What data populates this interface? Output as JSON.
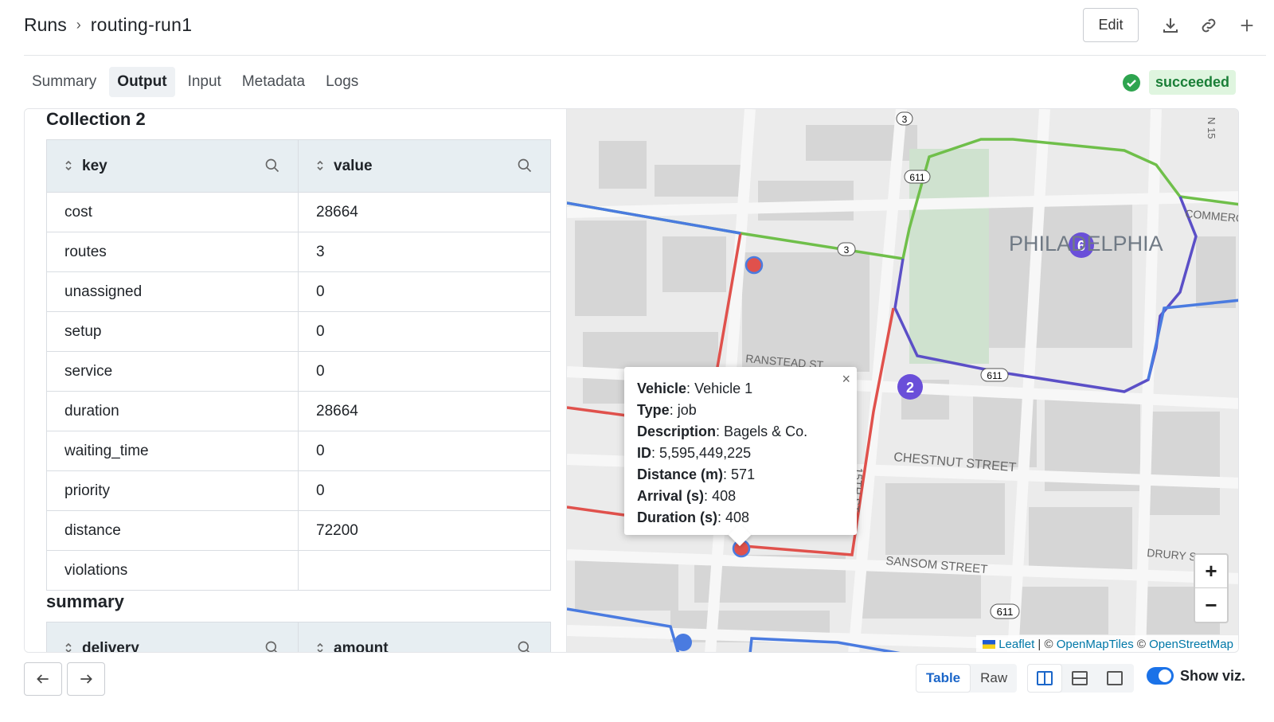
{
  "breadcrumb": {
    "root": "Runs",
    "separator": "›",
    "current": "routing-run1"
  },
  "toolbar": {
    "edit_label": "Edit"
  },
  "tabs": [
    {
      "label": "Summary",
      "active": false
    },
    {
      "label": "Output",
      "active": true
    },
    {
      "label": "Input",
      "active": false
    },
    {
      "label": "Metadata",
      "active": false
    },
    {
      "label": "Logs",
      "active": false
    }
  ],
  "status": {
    "label": "succeeded",
    "color": "#1a7f37"
  },
  "collection": {
    "title": "Collection 2",
    "columns": [
      "key",
      "value"
    ],
    "rows": [
      {
        "key": "cost",
        "value": "28664"
      },
      {
        "key": "routes",
        "value": "3"
      },
      {
        "key": "unassigned",
        "value": "0"
      },
      {
        "key": "setup",
        "value": "0"
      },
      {
        "key": "service",
        "value": "0"
      },
      {
        "key": "duration",
        "value": "28664"
      },
      {
        "key": "waiting_time",
        "value": "0"
      },
      {
        "key": "priority",
        "value": "0"
      },
      {
        "key": "distance",
        "value": "72200"
      },
      {
        "key": "violations",
        "value": ""
      }
    ]
  },
  "summary": {
    "title": "summary",
    "columns": [
      "delivery",
      "amount"
    ]
  },
  "map": {
    "labels": {
      "city": "PHILADELPHIA",
      "ranstead": "RANSTEAD ST",
      "chestnut": "CHESTNUT STREET",
      "sansom": "SANSOM STREET",
      "drury": "DRURY S",
      "commerce": "COMMERC",
      "n15": "N 15",
      "s15": "15TH ST",
      "shield_3": "3",
      "shield_611": "611"
    },
    "clusters": [
      {
        "count": "6"
      },
      {
        "count": "2"
      }
    ],
    "popup": {
      "close": "×",
      "rows": [
        {
          "label": "Vehicle",
          "value": "Vehicle 1"
        },
        {
          "label": "Type",
          "value": "job"
        },
        {
          "label": "Description",
          "value": "Bagels & Co."
        },
        {
          "label": "ID",
          "value": "5,595,449,225"
        },
        {
          "label": "Distance (m)",
          "value": "571"
        },
        {
          "label": "Arrival (s)",
          "value": "408"
        },
        {
          "label": "Duration (s)",
          "value": "408"
        }
      ]
    },
    "zoom_in": "+",
    "zoom_out": "−",
    "attribution": {
      "leaflet": "Leaflet",
      "sep": " | © ",
      "tiles": "OpenMapTiles",
      "sep2": " © ",
      "osm": "OpenStreetMap"
    },
    "route_colors": {
      "red": "#e0514c",
      "blue": "#4a7be0",
      "purple": "#5b4fc7",
      "green": "#6fbf4a"
    }
  },
  "footer": {
    "view_table": "Table",
    "view_raw": "Raw",
    "show_viz": "Show viz."
  }
}
